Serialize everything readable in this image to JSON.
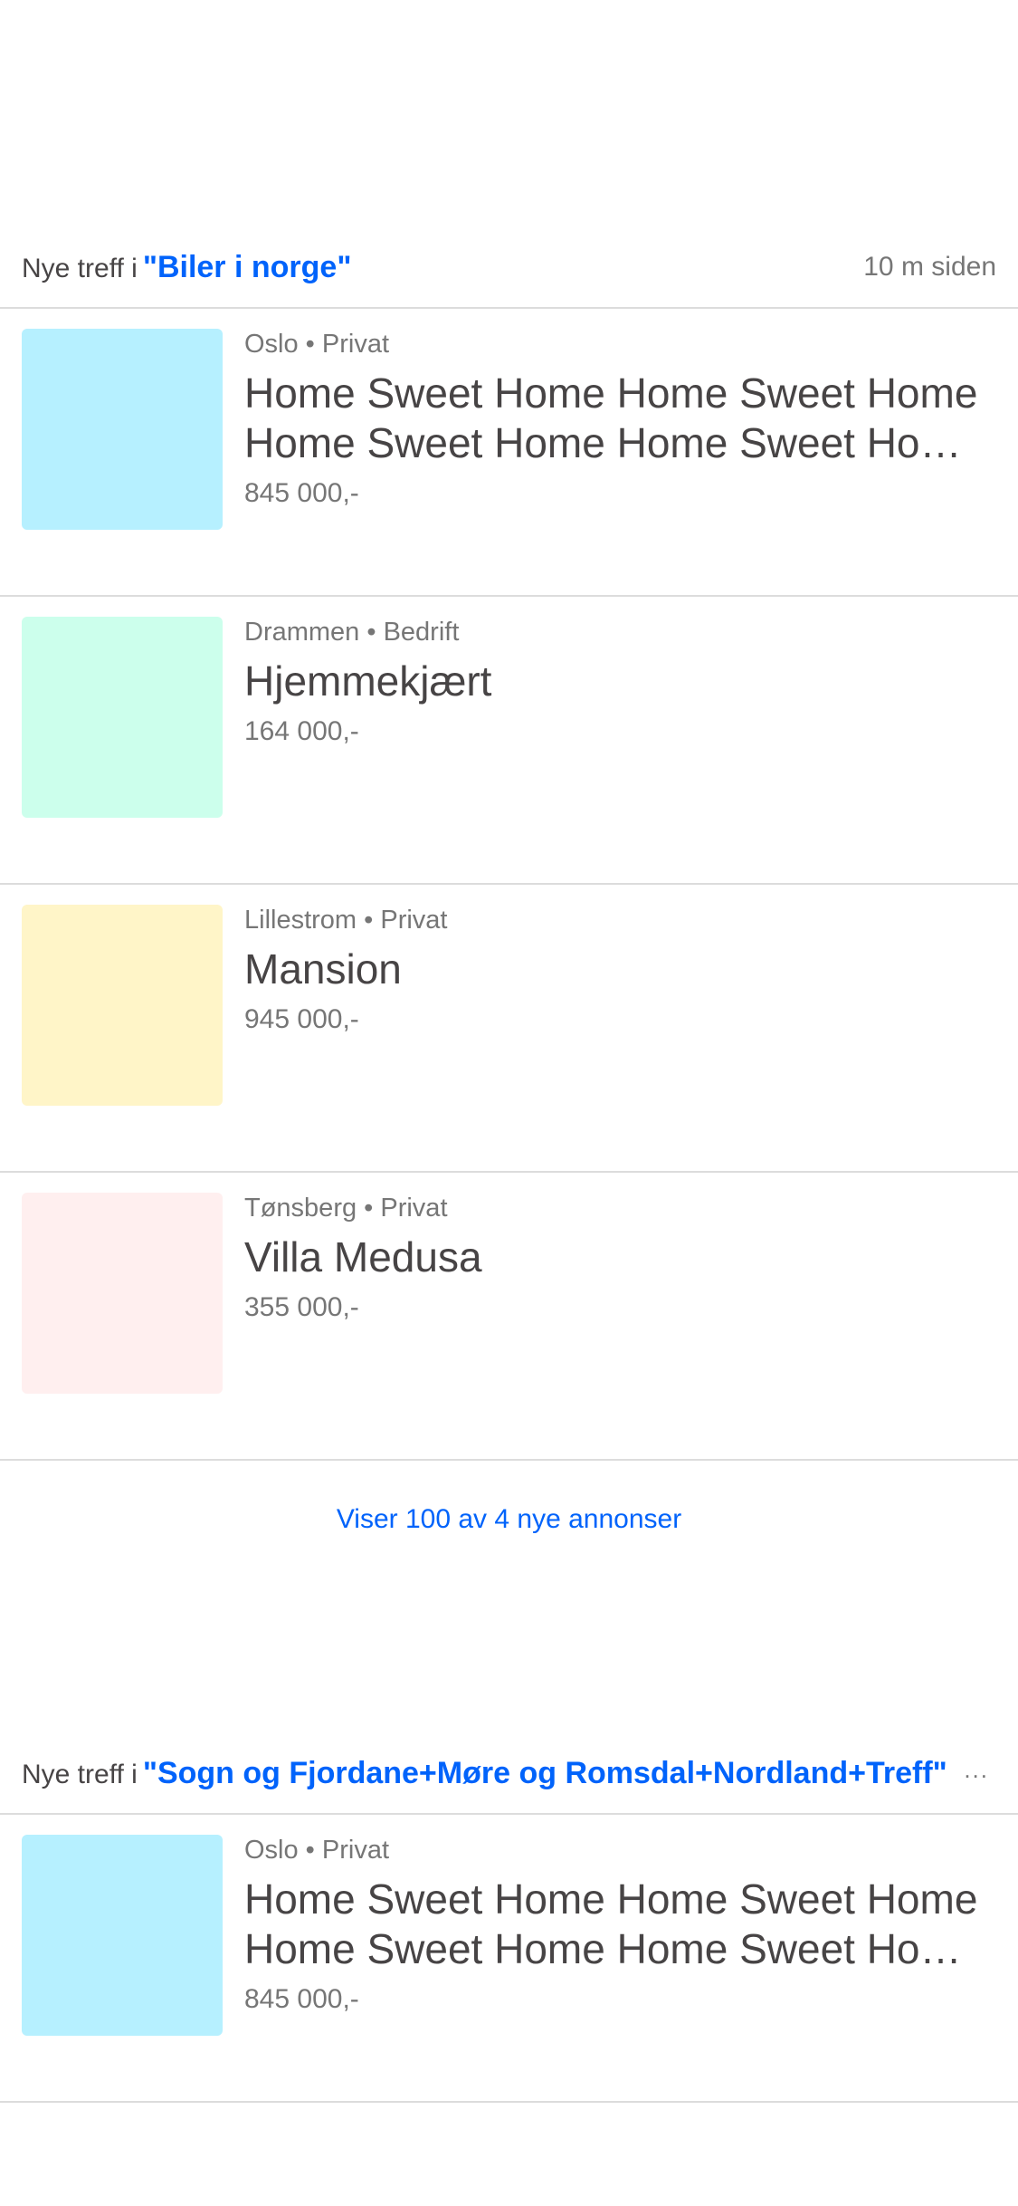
{
  "sections": [
    {
      "prefix": "Nye treff i",
      "query": "\"Biler i norge\"",
      "time": "10 m siden",
      "listings": [
        {
          "meta": "Oslo • Privat",
          "title": "Home Sweet Home Home Sweet Home Home Sweet Home Home Sweet Home Home Sweet Home",
          "price": "845 000,-",
          "color": "#b6f0ff"
        },
        {
          "meta": "Drammen • Bedrift",
          "title": "Hjemmekjært",
          "price": "164 000,-",
          "color": "#ccffec"
        },
        {
          "meta": "Lillestrom • Privat",
          "title": "Mansion",
          "price": "945 000,-",
          "color": "#fff5c8"
        },
        {
          "meta": "Tønsberg • Privat",
          "title": "Villa Medusa",
          "price": "355 000,-",
          "color": "#ffefef"
        }
      ],
      "show_more": "Viser 100 av 4 nye annonser"
    },
    {
      "prefix": "Nye treff i",
      "query": "\"Sogn og Fjordane+Møre og Romsdal+Nordland+Treff\"",
      "more_icon": "...",
      "listings": [
        {
          "meta": "Oslo • Privat",
          "title": "Home Sweet Home Home Sweet Home Home Sweet Home Home Sweet Home Home Sweet Home",
          "price": "845 000,-",
          "color": "#b6f0ff"
        }
      ]
    }
  ]
}
